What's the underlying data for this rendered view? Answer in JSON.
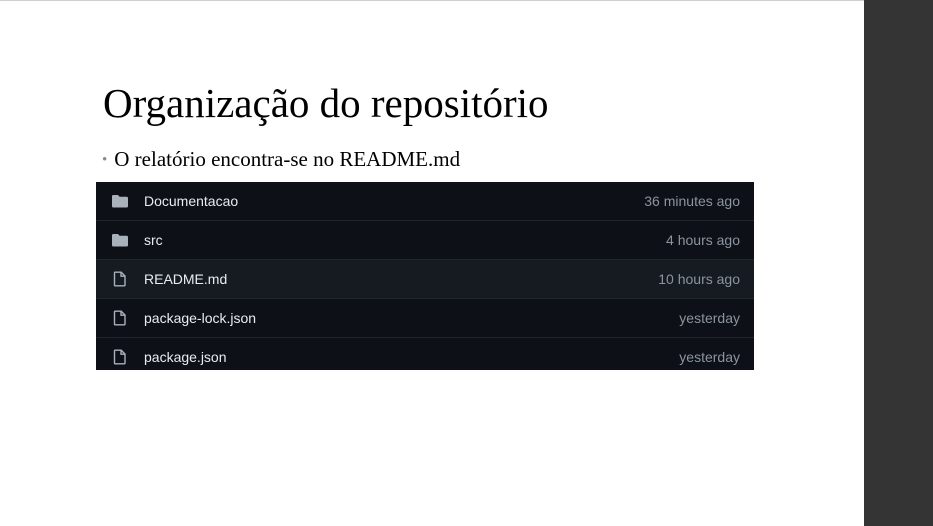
{
  "slide": {
    "title": "Organização do repositório",
    "bullet": "O relatório encontra-se no README.md"
  },
  "repo": {
    "files": [
      {
        "name": "Documentacao",
        "type": "folder",
        "icon": "folder-icon",
        "time": "36 minutes ago"
      },
      {
        "name": "src",
        "type": "folder",
        "icon": "folder-icon",
        "time": "4 hours ago"
      },
      {
        "name": "README.md",
        "type": "file",
        "icon": "file-icon",
        "time": "10 hours ago"
      },
      {
        "name": "package-lock.json",
        "type": "file",
        "icon": "file-icon",
        "time": "yesterday"
      },
      {
        "name": "package.json",
        "type": "file",
        "icon": "file-icon",
        "time": "yesterday"
      }
    ]
  },
  "colors": {
    "panel_bg": "#0d1117",
    "row_hover_bg": "#161b22",
    "text": "#e6edf3",
    "muted": "#8b949e",
    "side_panel": "#343434"
  }
}
